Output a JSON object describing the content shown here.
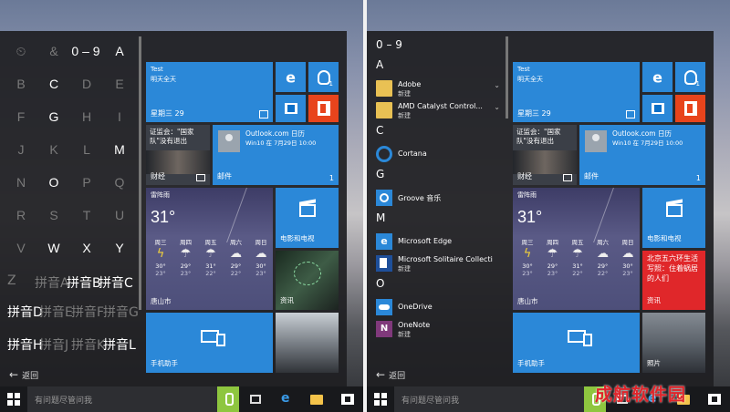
{
  "left": {
    "letters": [
      {
        "t": "⏲",
        "on": false
      },
      {
        "t": "&",
        "on": false
      },
      {
        "t": "0 – 9",
        "on": true
      },
      {
        "t": "A",
        "on": true
      },
      {
        "t": "B",
        "on": false
      },
      {
        "t": "C",
        "on": true
      },
      {
        "t": "D",
        "on": false
      },
      {
        "t": "E",
        "on": false
      },
      {
        "t": "F",
        "on": false
      },
      {
        "t": "G",
        "on": true
      },
      {
        "t": "H",
        "on": false
      },
      {
        "t": "I",
        "on": false
      },
      {
        "t": "J",
        "on": false
      },
      {
        "t": "K",
        "on": false
      },
      {
        "t": "L",
        "on": false
      },
      {
        "t": "M",
        "on": true
      },
      {
        "t": "N",
        "on": false
      },
      {
        "t": "O",
        "on": true
      },
      {
        "t": "P",
        "on": false
      },
      {
        "t": "Q",
        "on": false
      },
      {
        "t": "R",
        "on": false
      },
      {
        "t": "S",
        "on": false
      },
      {
        "t": "T",
        "on": false
      },
      {
        "t": "U",
        "on": false
      },
      {
        "t": "V",
        "on": false
      },
      {
        "t": "W",
        "on": true
      },
      {
        "t": "X",
        "on": true
      },
      {
        "t": "Y",
        "on": true
      }
    ],
    "pinyin_rows": [
      [
        "Z",
        "拼音A",
        "拼音B",
        "拼音C"
      ],
      [
        "拼音D",
        "拼音E",
        "拼音F",
        "拼音G"
      ],
      [
        "拼音H",
        "拼音J",
        "拼音K",
        "拼音L"
      ]
    ],
    "back": "返回"
  },
  "right": {
    "sections": [
      {
        "header": "0 – 9"
      },
      {
        "header": "A",
        "apps": [
          {
            "name": "Adobe",
            "sub": "新建",
            "icon": "folder-icon",
            "chev": "⌄"
          },
          {
            "name": "AMD Catalyst Control...",
            "sub": "新建",
            "icon": "folder-icon",
            "chev": "⌄"
          }
        ]
      },
      {
        "header": "C",
        "apps": [
          {
            "name": "Cortana",
            "icon": "cortana-icon"
          }
        ]
      },
      {
        "header": "G",
        "apps": [
          {
            "name": "Groove 音乐",
            "icon": "groove-icon"
          }
        ]
      },
      {
        "header": "M",
        "apps": [
          {
            "name": "Microsoft Edge",
            "icon": "edge-icon"
          },
          {
            "name": "Microsoft Solitaire Collecti...",
            "sub": "新建",
            "icon": "solitaire-icon"
          }
        ]
      },
      {
        "header": "O",
        "apps": [
          {
            "name": "OneDrive",
            "icon": "onedrive-icon"
          },
          {
            "name": "OneNote",
            "sub": "新建",
            "icon": "onenote-icon"
          }
        ]
      }
    ],
    "back": "返回"
  },
  "tiles": {
    "calendar": {
      "line1": "Test",
      "line2": "明天全天",
      "label": "星期三 29"
    },
    "news": {
      "headline": "证监会：\"国家队\"没有退出",
      "label": "财经"
    },
    "mail": {
      "line1": "Outlook.com 日历",
      "line2": "Win10 在 7月29日 10:00",
      "label": "邮件",
      "count": "1"
    },
    "qq_badge": "1",
    "weather": {
      "condition": "雷阵雨",
      "temp": "31°",
      "location": "唐山市",
      "days": [
        {
          "name": "周三",
          "sym": "ϟ",
          "hi": "30°",
          "lo": "23°"
        },
        {
          "name": "周四",
          "sym": "☂",
          "hi": "29°",
          "lo": "23°"
        },
        {
          "name": "周五",
          "sym": "☂",
          "hi": "31°",
          "lo": "22°"
        },
        {
          "name": "周六",
          "sym": "☁",
          "hi": "29°",
          "lo": "22°"
        },
        {
          "name": "周日",
          "sym": "☁",
          "hi": "30°",
          "lo": "23°"
        }
      ]
    },
    "movies": {
      "label": "电影和电视"
    },
    "news2": {
      "label": "资讯"
    },
    "red_news": {
      "text": "北京五六环生活写照：住着蜗居的人们",
      "label": "资讯"
    },
    "phone": {
      "label": "手机助手"
    },
    "photos": {
      "label": "照片"
    }
  },
  "taskbar": {
    "search_placeholder": "有问题尽管问我"
  },
  "watermark": "成航软件园"
}
